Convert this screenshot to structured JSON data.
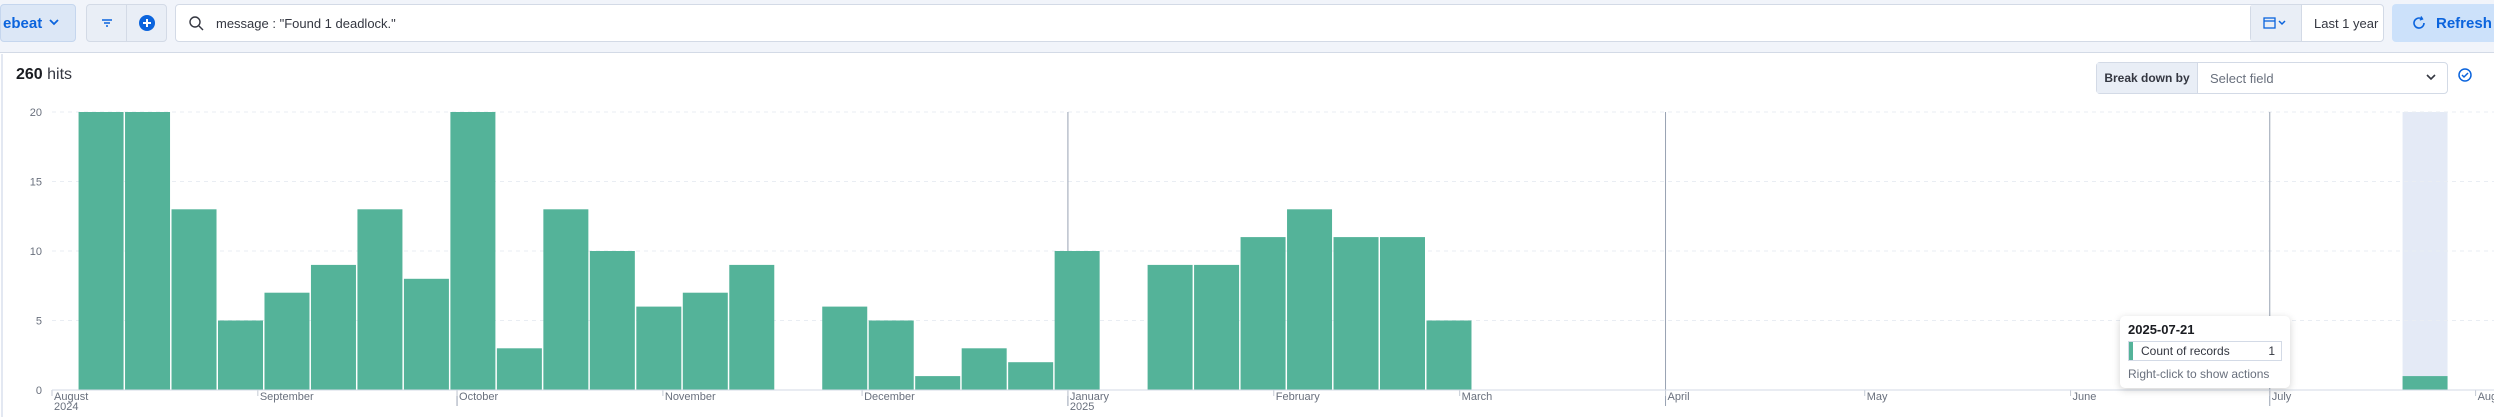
{
  "toolbar": {
    "dataview_label": "ebeat",
    "query_text": "message : \"Found 1 deadlock.\"",
    "date_range": "Last 1 year",
    "refresh_label": "Refresh"
  },
  "hits": {
    "count": "260",
    "label": "hits"
  },
  "breakdown": {
    "label": "Break down by",
    "placeholder": "Select field"
  },
  "tooltip": {
    "date": "2025-07-21",
    "series": "Count of records",
    "value": "1",
    "hint": "Right-click to show actions"
  },
  "colors": {
    "bar": "#54b399",
    "accent": "#0b64dd",
    "highlight_band": "#e4eaf6"
  },
  "chart_data": {
    "type": "bar",
    "ylim": [
      0,
      20
    ],
    "y_ticks": [
      "0",
      "5",
      "10",
      "15",
      "20"
    ],
    "interval": "week",
    "bars": [
      {
        "week": "2024-08-05",
        "value": 20
      },
      {
        "week": "2024-08-12",
        "value": 20
      },
      {
        "week": "2024-08-19",
        "value": 13
      },
      {
        "week": "2024-08-26",
        "value": 5
      },
      {
        "week": "2024-09-02",
        "value": 7
      },
      {
        "week": "2024-09-09",
        "value": 9
      },
      {
        "week": "2024-09-16",
        "value": 13
      },
      {
        "week": "2024-09-23",
        "value": 8
      },
      {
        "week": "2024-09-30",
        "value": 20
      },
      {
        "week": "2024-10-07",
        "value": 3
      },
      {
        "week": "2024-10-14",
        "value": 13
      },
      {
        "week": "2024-10-21",
        "value": 10
      },
      {
        "week": "2024-10-28",
        "value": 6
      },
      {
        "week": "2024-11-04",
        "value": 7
      },
      {
        "week": "2024-11-11",
        "value": 9
      },
      {
        "week": "2024-11-25",
        "value": 6
      },
      {
        "week": "2024-12-02",
        "value": 5
      },
      {
        "week": "2024-12-09",
        "value": 1
      },
      {
        "week": "2024-12-16",
        "value": 3
      },
      {
        "week": "2024-12-23",
        "value": 2
      },
      {
        "week": "2024-12-30",
        "value": 10
      },
      {
        "week": "2025-01-13",
        "value": 9
      },
      {
        "week": "2025-01-20",
        "value": 9
      },
      {
        "week": "2025-01-27",
        "value": 11
      },
      {
        "week": "2025-02-03",
        "value": 13
      },
      {
        "week": "2025-02-10",
        "value": 11
      },
      {
        "week": "2025-02-17",
        "value": 11
      },
      {
        "week": "2025-02-24",
        "value": 5
      },
      {
        "week": "2025-07-21",
        "value": 1
      }
    ],
    "x_ticks": [
      {
        "label": "August",
        "sub": "2024",
        "date": "2024-08-01"
      },
      {
        "label": "September",
        "sub": "",
        "date": "2024-09-01"
      },
      {
        "label": "October",
        "sub": "",
        "date": "2024-10-01"
      },
      {
        "label": "November",
        "sub": "",
        "date": "2024-11-01"
      },
      {
        "label": "December",
        "sub": "",
        "date": "2024-12-01"
      },
      {
        "label": "January",
        "sub": "2025",
        "date": "2025-01-01"
      },
      {
        "label": "February",
        "sub": "",
        "date": "2025-02-01"
      },
      {
        "label": "March",
        "sub": "",
        "date": "2025-03-01"
      },
      {
        "label": "April",
        "sub": "",
        "date": "2025-04-01"
      },
      {
        "label": "May",
        "sub": "",
        "date": "2025-05-01"
      },
      {
        "label": "June",
        "sub": "",
        "date": "2025-06-01"
      },
      {
        "label": "July",
        "sub": "",
        "date": "2025-07-01"
      },
      {
        "label": "August",
        "sub": "",
        "date": "2025-08-01"
      }
    ],
    "highlighted_week": "2025-07-21"
  }
}
